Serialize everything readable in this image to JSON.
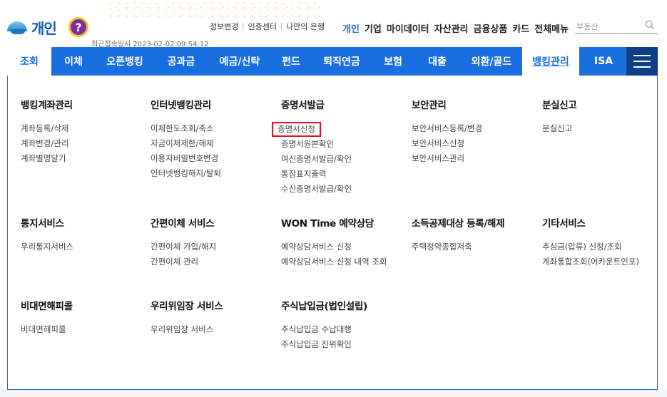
{
  "header": {
    "logo_text": "개인",
    "help_symbol": "?",
    "login_info": "최근접속일시 2023-02-02 09:54:12",
    "util_links": [
      "정보변경",
      "인증센터",
      "나만의 은행"
    ],
    "top_menu": [
      {
        "label": "개인",
        "active": true
      },
      {
        "label": "기업",
        "active": false
      },
      {
        "label": "마이데이터",
        "active": false
      },
      {
        "label": "자산관리",
        "active": false
      },
      {
        "label": "금융상품",
        "active": false
      },
      {
        "label": "카드",
        "active": false
      },
      {
        "label": "전체메뉴",
        "active": false
      }
    ],
    "search_placeholder": "부동산"
  },
  "nav": {
    "tabs": [
      {
        "label": "조회",
        "selected": true
      },
      {
        "label": "이체",
        "selected": false
      },
      {
        "label": "오픈뱅킹",
        "selected": false
      },
      {
        "label": "공과금",
        "selected": false
      },
      {
        "label": "예금/신탁",
        "selected": false
      },
      {
        "label": "펀드",
        "selected": false
      },
      {
        "label": "퇴직연금",
        "selected": false
      },
      {
        "label": "보험",
        "selected": false
      },
      {
        "label": "대출",
        "selected": false
      },
      {
        "label": "외환/골드",
        "selected": false
      },
      {
        "label": "뱅킹관리",
        "selected": true
      },
      {
        "label": "ISA",
        "selected": false
      }
    ]
  },
  "panel": {
    "sections": [
      {
        "title": "뱅킹계좌관리",
        "items": [
          "계좌등록/삭제",
          "계좌변경/관리",
          "계좌별명달기"
        ]
      },
      {
        "title": "인터넷뱅킹관리",
        "items": [
          "이체한도조회/축소",
          "자금이체제한/해제",
          "이용자비밀번호변경",
          "인터넷뱅킹해지/탈퇴"
        ]
      },
      {
        "title": "증명서발급",
        "items": [
          "증명서신청",
          "증명서원본확인",
          "여신증명서발급/확인",
          "통장표지출력",
          "수신증명서발급/확인"
        ]
      },
      {
        "title": "보안관리",
        "items": [
          "보안서비스등록/변경",
          "보안서비스신청",
          "보안서비스관리"
        ]
      },
      {
        "title": "분실신고",
        "items": [
          "분실신고"
        ]
      },
      {
        "title": "통지서비스",
        "items": [
          "우리통지서비스"
        ]
      },
      {
        "title": "간편이체 서비스",
        "items": [
          "간편이체 가입/해지",
          "간편이체 관리"
        ]
      },
      {
        "title": "WON Time 예약상담",
        "items": [
          "예약상담서비스 신청",
          "예약상담서비스 신청 내역 조회"
        ]
      },
      {
        "title": "소득공제대상 등록/해제",
        "items": [
          "주택청약종합저축"
        ]
      },
      {
        "title": "기타서비스",
        "items": [
          "추심금(압류) 신청/조회",
          "계좌통합조회(어카운트인포)"
        ]
      },
      {
        "title": "비대면해피콜",
        "items": [
          "비대면해피콜"
        ]
      },
      {
        "title": "우리위임장 서비스",
        "items": [
          "우리위임장 서비스"
        ]
      },
      {
        "title": "주식납입금(법인설립)",
        "items": [
          "주식납입금 수납대행",
          "주식납입금 진위확인"
        ]
      }
    ]
  }
}
